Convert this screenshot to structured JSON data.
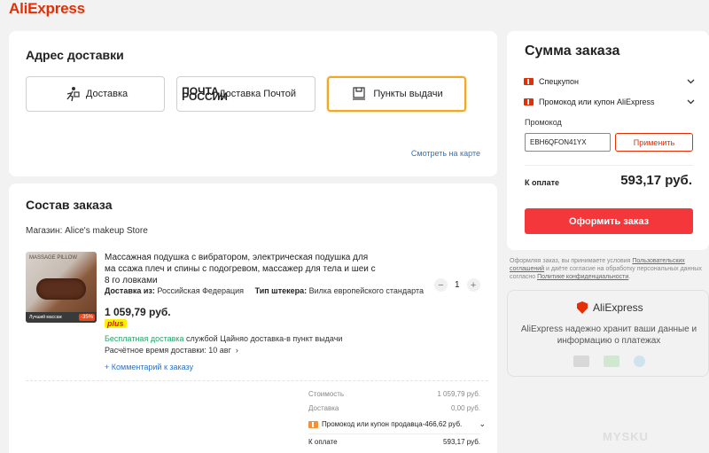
{
  "header": {
    "logo": "AliExpress"
  },
  "address": {
    "title": "Адрес доставки",
    "options": [
      {
        "label": "Доставка",
        "icon": "courier-icon",
        "active": false
      },
      {
        "label": "Доставка Почтой",
        "icon_text": "ПОЧТА РОССИИ",
        "active": false
      },
      {
        "label": "Пункты выдачи",
        "icon": "pickup-box-icon",
        "active": true
      }
    ],
    "map_link": "Смотреть на карте"
  },
  "order": {
    "title": "Состав заказа",
    "shop": "Магазин: Alice's makeup Store",
    "product": {
      "title": "Массажная подушка с вибратором, электрическая подушка для ма ссажа плеч и спины с подогревом, массажер для тела и шеи с 8 го ловками",
      "ship_from_label": "Доставка из:",
      "ship_from_value": "Российская Федерация",
      "plug_label": "Тип штекера:",
      "plug_value": "Вилка европейского стандарта",
      "price": "1 059,79 руб.",
      "plus": "plus",
      "delivery_free": "Бесплатная доставка",
      "delivery_rest": "службой Цайняо доставка-в пункт выдачи",
      "estimate": "Расчётное время доставки: 10 авг",
      "comment": "+ Комментарий к заказу",
      "quantity": "1",
      "image_text": {
        "top": "MASSAGE PILLOW",
        "tag": "-35%",
        "mini": "Лучший массаж"
      }
    },
    "totals": {
      "cost_label": "Стоимость",
      "cost_value": "1 059,79 руб.",
      "shipping_label": "Доставка",
      "shipping_value": "0,00 руб.",
      "seller_promo": "Промокод или купон продавца-466,62 руб.",
      "pay_label": "К оплате",
      "pay_value": "593,17 руб."
    }
  },
  "summary": {
    "title": "Сумма заказа",
    "special_coupon": "Спецкупон",
    "ae_coupon": "Промокод или купон AliExpress",
    "promo_label": "Промокод",
    "promo_value": "EBH6QFON41YX",
    "apply": "Применить",
    "pay_label": "К оплате",
    "pay_value": "593,17 руб.",
    "checkout": "Оформить заказ"
  },
  "terms": {
    "prefix": "Оформляя заказ, вы принимаете условия ",
    "link1": "Пользовательских соглашений",
    "middle": " и даёте согласие на обработку персональных данных согласно ",
    "link2": "Политике конфиденциальности",
    "suffix": "."
  },
  "secure": {
    "logo": "AliExpress",
    "text": "AliExpress надежно хранит ваши данные и информацию о платежах"
  },
  "watermark": "MYSKU"
}
